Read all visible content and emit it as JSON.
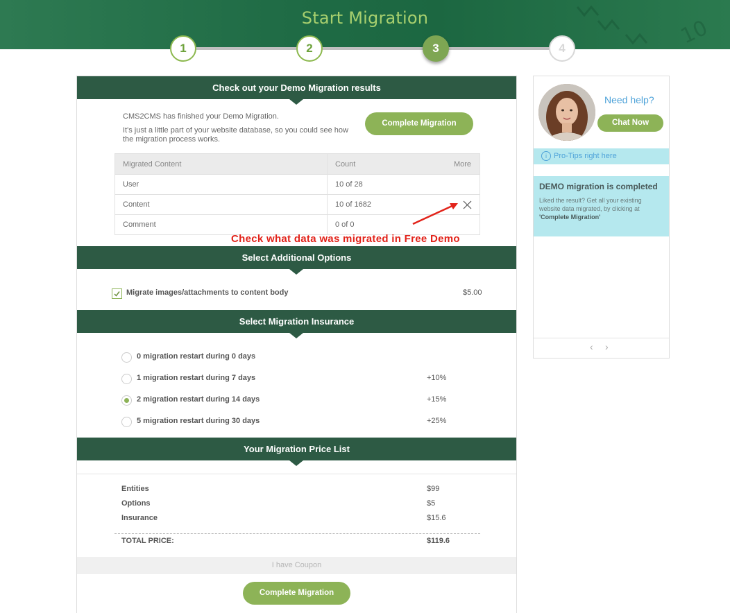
{
  "header": {
    "title": "Start Migration"
  },
  "steps": [
    "1",
    "2",
    "3",
    "4"
  ],
  "demo": {
    "section_title": "Check out your Demo Migration results",
    "line1": "CMS2CMS has finished your Demo Migration.",
    "line2": "It's just a little part of your website database, so you could see how the migration process works.",
    "complete_button": "Complete Migration",
    "table": {
      "headers": {
        "content": "Migrated Content",
        "count": "Count",
        "more": "More"
      },
      "rows": [
        {
          "name": "User",
          "count": "10 of 28"
        },
        {
          "name": "Content",
          "count": "10 of 1682"
        },
        {
          "name": "Comment",
          "count": "0 of 0"
        }
      ]
    },
    "annotation": "Check what data was migrated in Free Demo"
  },
  "options": {
    "section_title": "Select Additional Options",
    "item_label": "Migrate images/attachments to content body",
    "item_price": "$5.00",
    "checked": true
  },
  "insurance": {
    "section_title": "Select Migration Insurance",
    "items": [
      {
        "label": "0 migration restart during 0 days",
        "price": ""
      },
      {
        "label": "1 migration restart during 7 days",
        "price": "+10%"
      },
      {
        "label": "2 migration restart during 14 days",
        "price": "+15%"
      },
      {
        "label": "5 migration restart during 30 days",
        "price": "+25%"
      }
    ],
    "selected_index": 2
  },
  "price_list": {
    "section_title": "Your Migration Price List",
    "items": [
      {
        "label": "Entities",
        "value": "$99"
      },
      {
        "label": "Options",
        "value": "$5"
      },
      {
        "label": "Insurance",
        "value": "$15.6"
      }
    ],
    "total_label": "TOTAL PRICE:",
    "total_value": "$119.6",
    "coupon": "I have Coupon",
    "complete_button": "Complete Migration"
  },
  "sidebar": {
    "need_help": "Need help?",
    "chat_button": "Chat Now",
    "protips": "Pro-Tips right here",
    "tip_title": "DEMO migration is completed",
    "tip_body_1": "Liked the result? Get all your existing website data migrated, by clicking at ",
    "tip_body_strong": "'Complete Migration'",
    "prev": "‹",
    "next": "›"
  },
  "colors": {
    "banner": "#1f6b45",
    "section_header": "#2d5a44",
    "accent_green": "#8db357",
    "annotation_red": "#e2231a",
    "tip_bg": "#b5e8ee",
    "link_blue": "#4fa3d9"
  }
}
